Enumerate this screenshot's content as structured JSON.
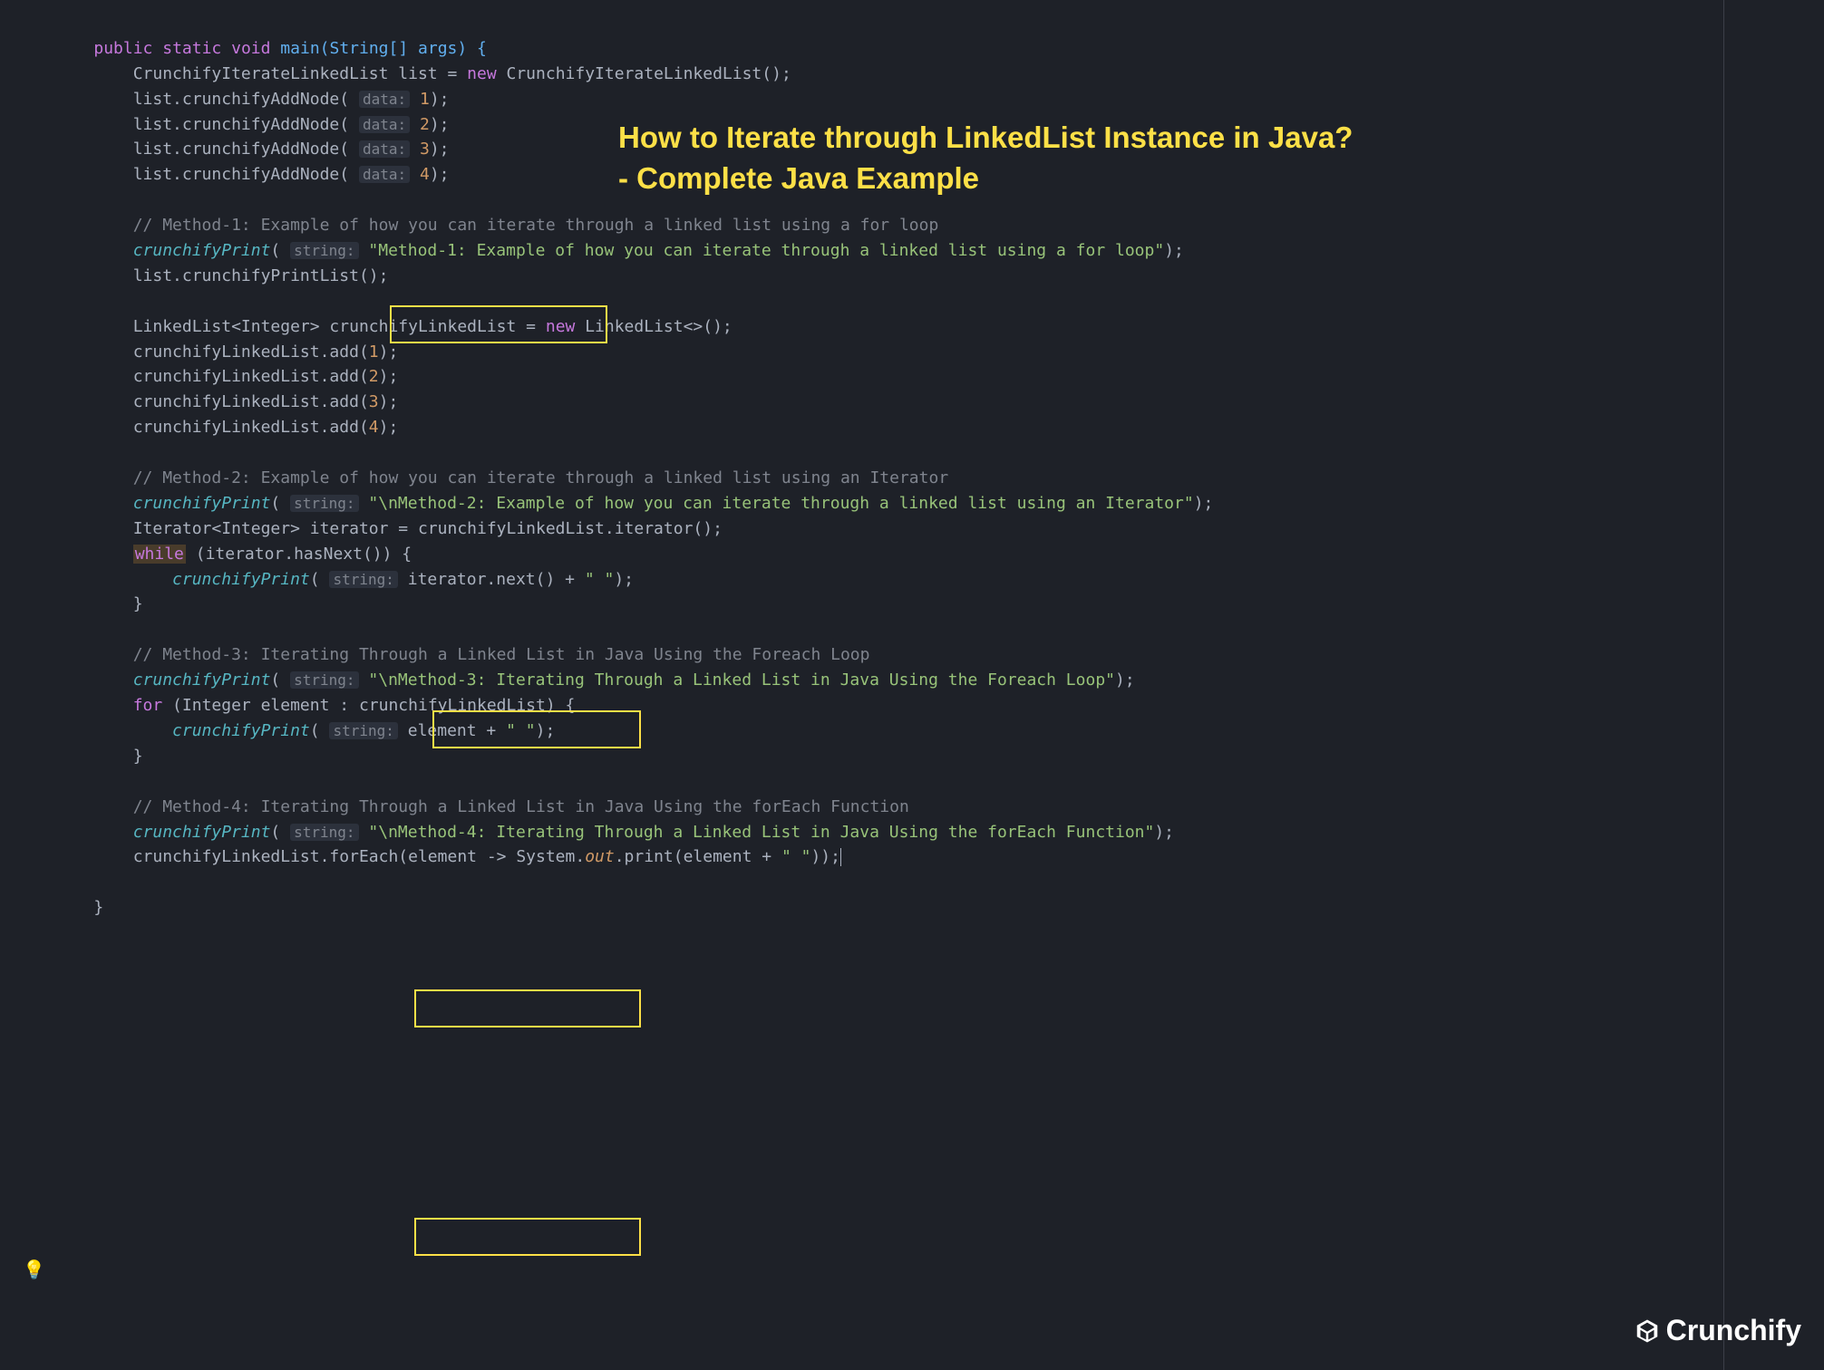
{
  "title": {
    "line1": "How to Iterate through LinkedList Instance in Java?",
    "line2": "- Complete Java Example"
  },
  "logo_text": "Crunchify",
  "keywords": {
    "public": "public",
    "static": "static",
    "void": "void",
    "new": "new",
    "while": "while",
    "for": "for"
  },
  "hints": {
    "data": "data:",
    "string": "string:"
  },
  "code": {
    "main_sig_open": " main(String[] args) {",
    "l2": "        CrunchifyIterateLinkedList list = ",
    "l2b": " CrunchifyIterateLinkedList();",
    "add_open": "        list.crunchifyAddNode( ",
    "add_close": ");",
    "n1": "1",
    "n2": "2",
    "n3": "3",
    "n4": "4",
    "c1": "        // Method-1: Example of how you can iterate through a linked list using a for loop",
    "cp_open": "        ",
    "cp_fn": "crunchifyPrint",
    "cp_o": "( ",
    "cp_c": ");",
    "s1": "\"Method-1: Example of how you can iterate through a linked list using a for loop\"",
    "printlist": "        list.crunchifyPrintList();",
    "ll_decl_a": "        LinkedList<Integer> crunchifyLinkedList = ",
    "ll_decl_b": " LinkedList<>();",
    "ll_add_o": "        crunchifyLinkedList.add(",
    "ll_add_c": ");",
    "c2": "        // Method-2: Example of how you can iterate through a linked list using an Iterator",
    "s2": "\"\\nMethod-2: Example of how you can iterate through a linked list using an Iterator\"",
    "iter_decl": "        Iterator<Integer> iterator = crunchifyLinkedList.iterator();",
    "while_cond": " (iterator.hasNext()) {",
    "while_body_a": "            ",
    "while_body_b": "iterator.next() + ",
    "space_str": "\" \"",
    "close_brace": "        }",
    "c3": "        // Method-3: Iterating Through a Linked List in Java Using the Foreach Loop",
    "s3": "\"\\nMethod-3: Iterating Through a Linked List in Java Using the Foreach Loop\"",
    "for_head": " (Integer element : crunchifyLinkedList) {",
    "for_body": "element + ",
    "c4": "        // Method-4: Iterating Through a Linked List in Java Using the forEach Function",
    "s4": "\"\\nMethod-4: Iterating Through a Linked List in Java Using the forEach Function\"",
    "foreach_a": "        crunchifyLinkedList.forEach(element -> System.",
    "foreach_out": "out",
    "foreach_b": ".print(element + ",
    "foreach_c": "));",
    "final_brace": "    }"
  }
}
